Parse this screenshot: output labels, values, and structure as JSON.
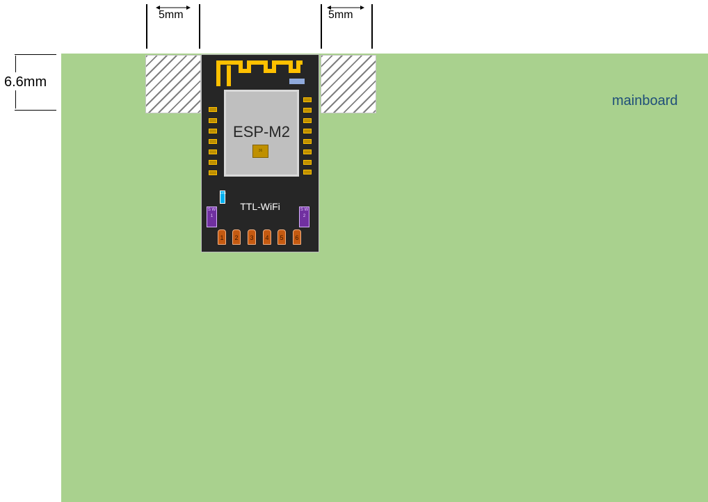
{
  "mainboard": {
    "label": "mainboard"
  },
  "keepout": {
    "left_width_label": "5mm",
    "right_width_label": "5mm",
    "height_label": "6.6mm"
  },
  "module": {
    "chip_name": "ESP-M2",
    "chip_core_label": "36",
    "model_label": "TTL-WiFi",
    "led_label": "LED",
    "sw_left_label": "S W 1",
    "sw_right_label": "S W 2",
    "pins": [
      "1",
      "2",
      "3",
      "4",
      "5",
      "6"
    ]
  },
  "colors": {
    "mainboard": "#a9d18e",
    "module_pcb": "#262626",
    "antenna": "#ffc000",
    "shield": "#bfbfbf",
    "mainboard_label": "#1f4e79"
  }
}
